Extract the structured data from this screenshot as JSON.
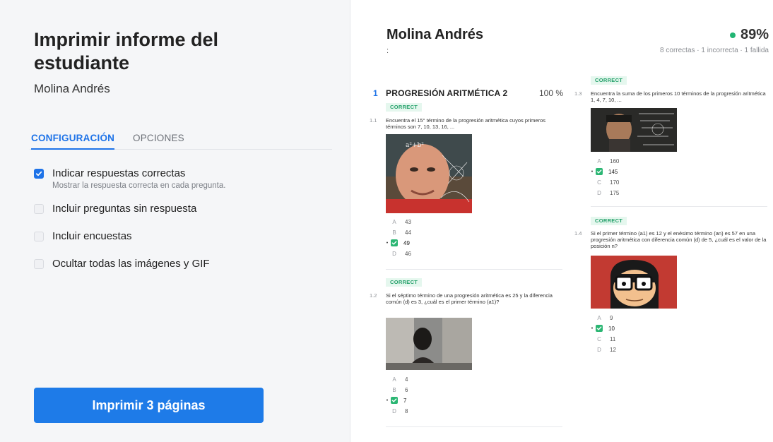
{
  "left": {
    "title": "Imprimir informe del estudiante",
    "student": "Molina Andrés",
    "tabs": [
      "CONFIGURACIÓN",
      "OPCIONES"
    ],
    "options": [
      {
        "label": "Indicar respuestas correctas",
        "sub": "Mostrar la respuesta correcta en cada pregunta.",
        "checked": true
      },
      {
        "label": "Incluir preguntas sin respuesta",
        "checked": false
      },
      {
        "label": "Incluir encuestas",
        "checked": false
      },
      {
        "label": "Ocultar todas las imágenes y GIF",
        "checked": false
      }
    ],
    "print_button": "Imprimir 3 páginas"
  },
  "report": {
    "student": "Molina Andrés",
    "colon": ":",
    "score": "89%",
    "summary": "8 correctas · 1 incorrecta · 1 fallida",
    "section": {
      "number": "1",
      "title": "PROGRESIÓN ARITMÉTICA 2",
      "percent": "100 %"
    },
    "badge": "CORRECT",
    "questions": [
      {
        "num": "1.1",
        "text": "Encuentra el 15° término de la progresión aritmética cuyos primeros términos son 7, 10, 13, 16, ...",
        "answers": [
          {
            "letter": "A",
            "value": "43"
          },
          {
            "letter": "B",
            "value": "44"
          },
          {
            "letter": "C",
            "value": "49",
            "correct": true
          },
          {
            "letter": "D",
            "value": "46"
          }
        ]
      },
      {
        "num": "1.2",
        "text": "Si el séptimo término de una progresión aritmética es 25 y la diferencia común (d) es 3, ¿cuál es el primer término (a1)?",
        "answers": [
          {
            "letter": "A",
            "value": "4"
          },
          {
            "letter": "B",
            "value": "6"
          },
          {
            "letter": "C",
            "value": "7",
            "correct": true
          },
          {
            "letter": "D",
            "value": "8"
          }
        ]
      },
      {
        "num": "1.3",
        "text": "Encuentra la suma de los primeros 10 términos de la progresión aritmética 1, 4, 7, 10, ...",
        "answers": [
          {
            "letter": "A",
            "value": "160"
          },
          {
            "letter": "B",
            "value": "145",
            "correct": true
          },
          {
            "letter": "C",
            "value": "170"
          },
          {
            "letter": "D",
            "value": "175"
          }
        ]
      },
      {
        "num": "1.4",
        "text": "Si el primer término (a1) es 12 y el enésimo término (an) es 57 en una progresión aritmética con diferencia común (d) de 5, ¿cuál es el valor de la posición n?",
        "answers": [
          {
            "letter": "A",
            "value": "9"
          },
          {
            "letter": "B",
            "value": "10",
            "correct": true
          },
          {
            "letter": "C",
            "value": "11"
          },
          {
            "letter": "D",
            "value": "12"
          }
        ]
      }
    ]
  },
  "colors": {
    "accent": "#1e73e8",
    "correct": "#2bb673",
    "score_dot": "#22b573",
    "badge_bg": "#e5f7ee"
  }
}
